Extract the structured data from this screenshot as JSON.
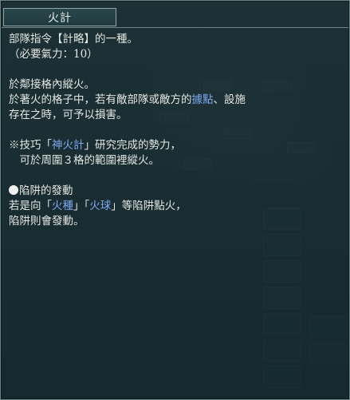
{
  "tooltip": {
    "title": "火計",
    "lines": {
      "l1": "部隊指令【計略】的一種。",
      "l2": "（必要氣力：10）",
      "l3": "於鄰接格內縱火。",
      "l4a": "於著火的格子中，若有敵部隊或敵方的",
      "l4b": "據點",
      "l4c": "、設施",
      "l5": "存在之時，可予以損害。",
      "l6a": "※技巧「",
      "l6b": "神火計",
      "l6c": "」研究完成的勢力，",
      "l7": "　可於周圍３格的範圍裡縱火。",
      "l8": "陷阱的發動",
      "l9a": "若是向「",
      "l9b": "火種",
      "l9c": "」「",
      "l9d": "火球",
      "l9e": "」等陷阱點火，",
      "l10": "陷阱則會發動。"
    }
  },
  "colors": {
    "highlight": "#7fa9f0",
    "text": "#e4e8e4",
    "panel_border": "#6c8686"
  }
}
